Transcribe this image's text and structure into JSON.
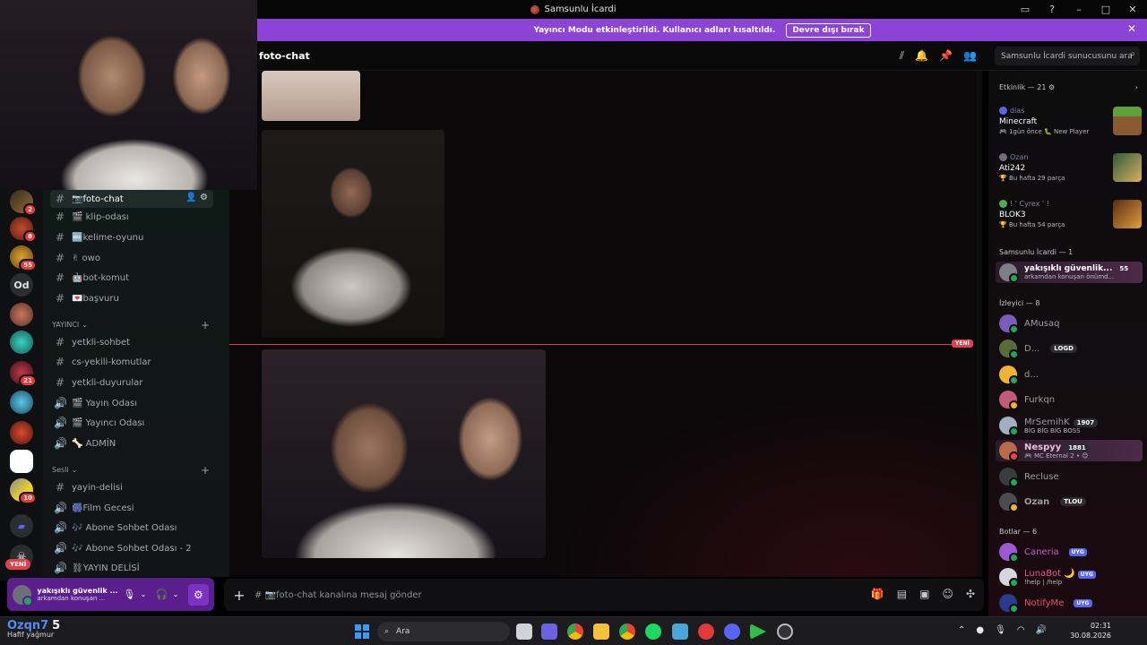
{
  "window": {
    "title": "Samsunlu İcardi"
  },
  "banner": {
    "text": "Yayıncı Modu etkinleştirildi. Kullanıcı adları kısaltıldı.",
    "button": "Devre dışı bırak"
  },
  "rail": {
    "badges": [
      "2",
      "8",
      "55",
      "21",
      "10"
    ],
    "od": "Od",
    "new": "YENİ"
  },
  "channels": {
    "items": [
      {
        "label": "📷foto-chat"
      },
      {
        "label": "🎬 klip-odası"
      },
      {
        "label": "🔤kelime-oyunu"
      },
      {
        "label": "✌ owo"
      },
      {
        "label": "🤖bot-komut"
      },
      {
        "label": "💌başvuru"
      }
    ],
    "cat_yayinci": "YAYINCI",
    "yayinci_items": [
      {
        "label": "yetkli-sohbet"
      },
      {
        "label": "cs-yekili-komutlar"
      },
      {
        "label": "yetkli-duyurular"
      },
      {
        "label": "🎬 Yayın Odası"
      },
      {
        "label": "🎬 Yayıncı Odası"
      },
      {
        "label": "🦴 ADMİN"
      }
    ],
    "cat_sesli": "Sesli",
    "sesli_items": [
      {
        "label": "yayin-delisi"
      },
      {
        "label": "🎆Film Gecesi"
      },
      {
        "label": "🎶 Abone Sohbet Odası"
      },
      {
        "label": "🎶 Abone Sohbet Odası - 2"
      },
      {
        "label": "⛓YAYIN DELİSİ"
      }
    ]
  },
  "user": {
    "name": "yakışıklı güvenlik ...",
    "status": "arkamdan konuşan ..."
  },
  "chat": {
    "channel": "foto-chat",
    "search_placeholder": "Samsunlu İcardi sunucusunu ara",
    "new_badge": "YENİ",
    "composer_placeholder": "# 📷foto-chat kanalına mesaj gönder"
  },
  "members": {
    "activity_header": "Etkinlik — 21 ⚙",
    "activities": [
      {
        "who": "dias",
        "game": "Minecraft",
        "sub": "🎮 1gün önce  🐛 New Player"
      },
      {
        "who": "Ozan",
        "game": "Ati242",
        "sub": "🏆 Bu hafta 29 parça"
      },
      {
        "who": "! ' Cyrex ' !",
        "game": "BLOK3",
        "sub": "🏆 Bu hafta 54 parça"
      }
    ],
    "group_owner": "Samsunlu İcardi — 1",
    "owner": {
      "name": "yakışıklı güvenlik...",
      "tag": "55",
      "status": "arkamdan konuşan önümd..."
    },
    "group_viewer": "İzleyici — 8",
    "viewers": [
      {
        "name": "AMusaq",
        "tag": "",
        "status": ""
      },
      {
        "name": "D...",
        "tag": "LOGD",
        "status": ""
      },
      {
        "name": "d...",
        "tag": "",
        "status": ""
      },
      {
        "name": "Furkqn",
        "tag": "",
        "status": ""
      },
      {
        "name": "MrSemihK",
        "tag": "1907",
        "status": "BİG BİG BİG BOSS"
      },
      {
        "name": "Nespyy",
        "tag": "1881",
        "status": "🎮 MC Eternal 2 • 😊"
      },
      {
        "name": "Recluse",
        "tag": "",
        "status": ""
      },
      {
        "name": "Ozan",
        "tag": "TLOU",
        "status": ""
      }
    ],
    "group_bots": "Botlar — 6",
    "bots": [
      {
        "name": "Caneria",
        "tag": "UYG",
        "status": ""
      },
      {
        "name": "LunaBot 🌙",
        "tag": "UYG",
        "status": "!help | /help"
      },
      {
        "name": "NotifyMe",
        "tag": "UYG",
        "status": ""
      }
    ]
  },
  "taskbar": {
    "weather_name": "Ozqn7",
    "weather_num": "5",
    "weather_desc": "Hafif yağmur",
    "search": "Ara",
    "time": "02:31",
    "date": "30.08.2026"
  },
  "colors": {
    "banner": "#8c44d6",
    "online": "#23a55a",
    "idle": "#f0b232",
    "dnd": "#f23f43",
    "new": "#e0404b"
  }
}
